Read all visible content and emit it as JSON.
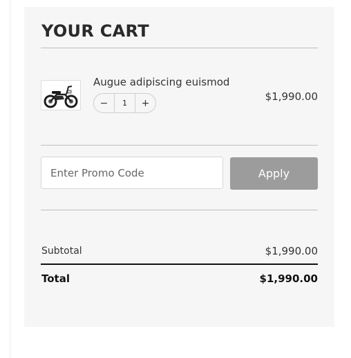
{
  "cart": {
    "title": "YOUR CART",
    "items": [
      {
        "name": "Augue adipiscing euismod",
        "image": "e-bike-thumbnail",
        "quantity": "1",
        "decrement_icon": "−",
        "increment_icon": "+",
        "price": "$1,990.00"
      }
    ]
  },
  "promo": {
    "placeholder": "Enter Promo Code",
    "value": "",
    "apply_label": "Apply"
  },
  "summary": {
    "subtotal_label": "Subtotal",
    "subtotal_value": "$1,990.00",
    "total_label": "Total",
    "total_value": "$1,990.00"
  },
  "colors": {
    "panel_background": "#f6f6f6",
    "apply_button": "#9c9c9c",
    "divider": "#bdbdbd",
    "total_rule": "#111111"
  }
}
